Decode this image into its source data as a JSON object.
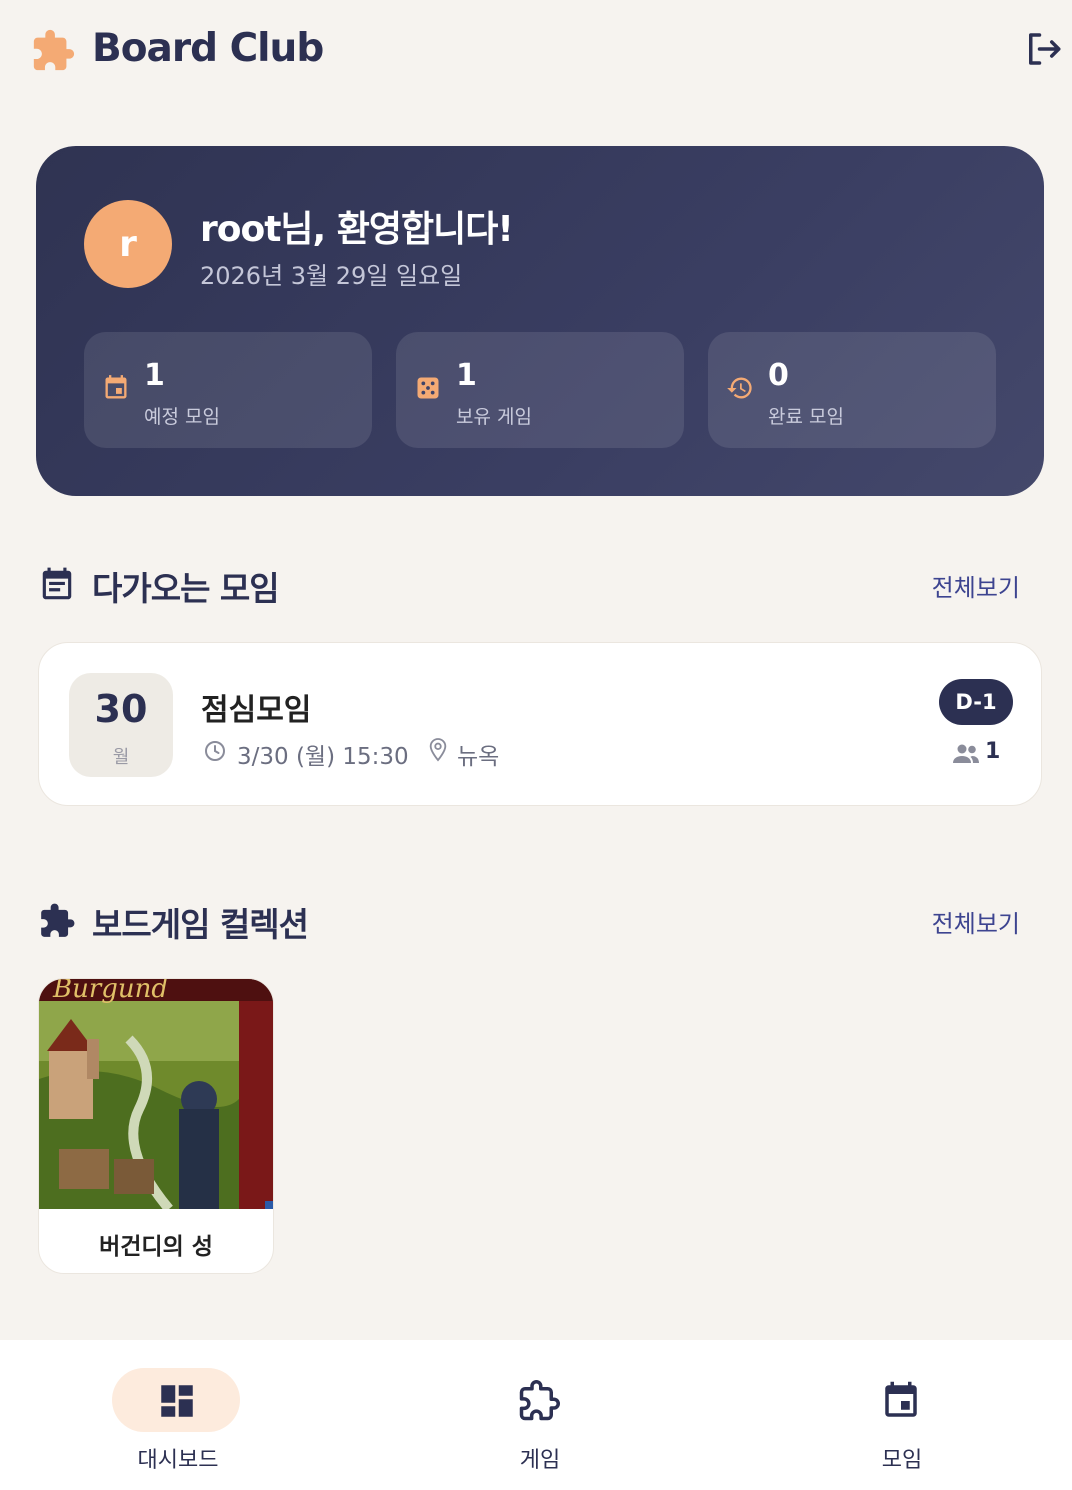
{
  "app": {
    "title": "Board Club"
  },
  "hero": {
    "avatar_letter": "r",
    "welcome": "root님, 환영합니다!",
    "date": "2026년 3월 29일 일요일",
    "stats": [
      {
        "value": "1",
        "label": "예정 모임",
        "icon": "calendar-icon"
      },
      {
        "value": "1",
        "label": "보유 게임",
        "icon": "dice-icon"
      },
      {
        "value": "0",
        "label": "완료 모임",
        "icon": "history-icon"
      }
    ]
  },
  "upcoming": {
    "title": "다가오는 모임",
    "view_all": "전체보기",
    "meeting": {
      "day": "30",
      "unit": "월",
      "name": "점심모임",
      "time": "3/30 (월) 15:30",
      "location": "뉴옥",
      "dday": "D-1",
      "participants": "1"
    }
  },
  "collection": {
    "title": "보드게임 컬렉션",
    "view_all": "전체보기",
    "games": [
      {
        "name": "버건디의 성",
        "cover_text": "Burgund"
      }
    ]
  },
  "nav": {
    "items": [
      {
        "label": "대시보드",
        "icon": "dashboard-icon",
        "active": true
      },
      {
        "label": "게임",
        "icon": "puzzle-icon",
        "active": false
      },
      {
        "label": "모임",
        "icon": "event-icon",
        "active": false
      }
    ]
  },
  "colors": {
    "accent": "#f4aa74",
    "navy": "#2c3052",
    "background": "#f6f3ef"
  }
}
